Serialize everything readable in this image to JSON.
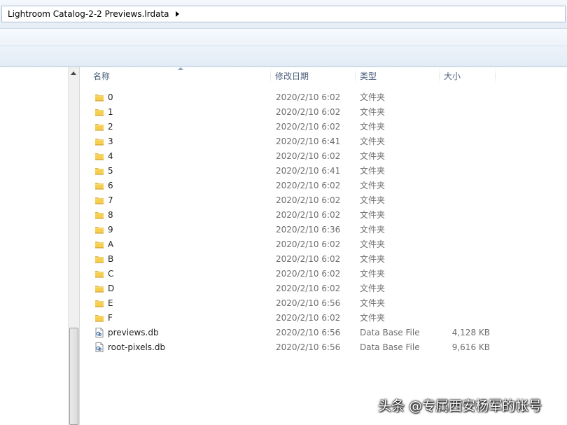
{
  "address": {
    "path": "Lightroom Catalog-2-2 Previews.lrdata"
  },
  "columns": {
    "name": "名称",
    "date": "修改日期",
    "type": "类型",
    "size": "大小"
  },
  "files": [
    {
      "name": "0",
      "date": "2020/2/10 6:02",
      "type": "文件夹",
      "size": "",
      "icon": "folder-icon"
    },
    {
      "name": "1",
      "date": "2020/2/10 6:02",
      "type": "文件夹",
      "size": "",
      "icon": "folder-icon"
    },
    {
      "name": "2",
      "date": "2020/2/10 6:02",
      "type": "文件夹",
      "size": "",
      "icon": "folder-icon"
    },
    {
      "name": "3",
      "date": "2020/2/10 6:41",
      "type": "文件夹",
      "size": "",
      "icon": "folder-icon"
    },
    {
      "name": "4",
      "date": "2020/2/10 6:02",
      "type": "文件夹",
      "size": "",
      "icon": "folder-icon"
    },
    {
      "name": "5",
      "date": "2020/2/10 6:41",
      "type": "文件夹",
      "size": "",
      "icon": "folder-icon"
    },
    {
      "name": "6",
      "date": "2020/2/10 6:02",
      "type": "文件夹",
      "size": "",
      "icon": "folder-icon"
    },
    {
      "name": "7",
      "date": "2020/2/10 6:02",
      "type": "文件夹",
      "size": "",
      "icon": "folder-icon"
    },
    {
      "name": "8",
      "date": "2020/2/10 6:02",
      "type": "文件夹",
      "size": "",
      "icon": "folder-icon"
    },
    {
      "name": "9",
      "date": "2020/2/10 6:36",
      "type": "文件夹",
      "size": "",
      "icon": "folder-icon"
    },
    {
      "name": "A",
      "date": "2020/2/10 6:02",
      "type": "文件夹",
      "size": "",
      "icon": "folder-icon"
    },
    {
      "name": "B",
      "date": "2020/2/10 6:02",
      "type": "文件夹",
      "size": "",
      "icon": "folder-icon"
    },
    {
      "name": "C",
      "date": "2020/2/10 6:02",
      "type": "文件夹",
      "size": "",
      "icon": "folder-icon"
    },
    {
      "name": "D",
      "date": "2020/2/10 6:02",
      "type": "文件夹",
      "size": "",
      "icon": "folder-icon"
    },
    {
      "name": "E",
      "date": "2020/2/10 6:56",
      "type": "文件夹",
      "size": "",
      "icon": "folder-icon"
    },
    {
      "name": "F",
      "date": "2020/2/10 6:02",
      "type": "文件夹",
      "size": "",
      "icon": "folder-icon"
    },
    {
      "name": "previews.db",
      "date": "2020/2/10 6:56",
      "type": "Data Base File",
      "size": "4,128 KB",
      "icon": "database-file-icon"
    },
    {
      "name": "root-pixels.db",
      "date": "2020/2/10 6:56",
      "type": "Data Base File",
      "size": "9,616 KB",
      "icon": "database-file-icon"
    }
  ],
  "watermark": "头条 @专属西安杨军的帐号"
}
